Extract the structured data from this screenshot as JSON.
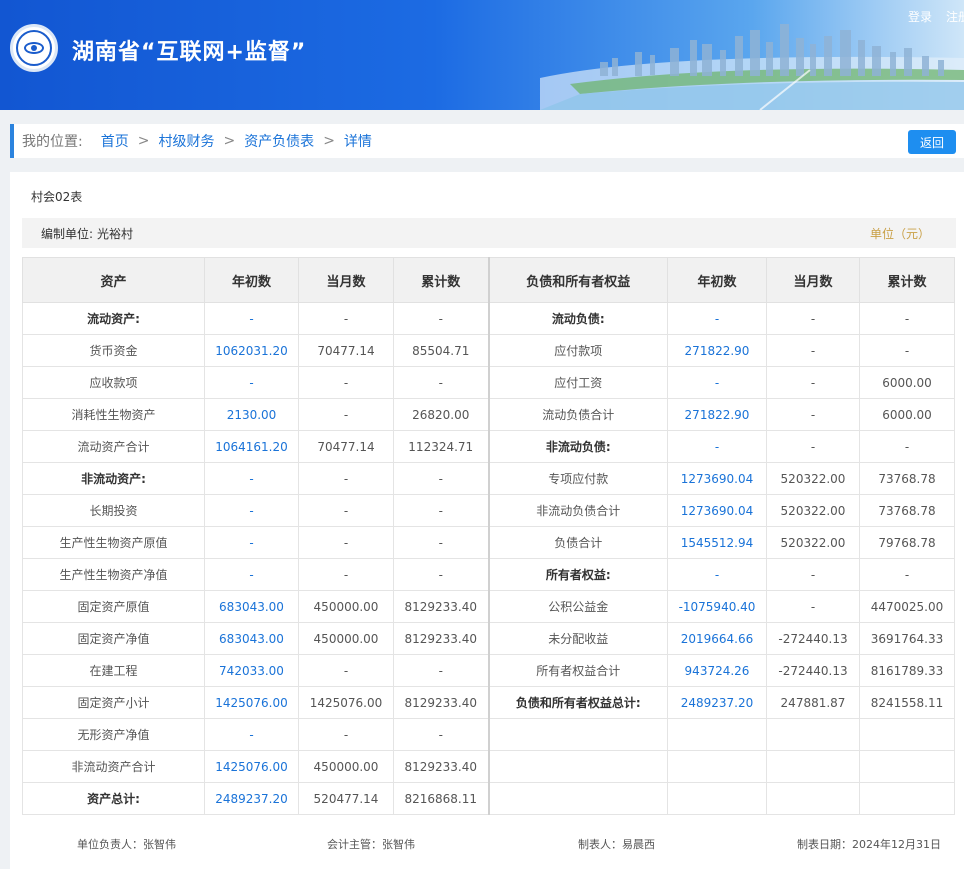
{
  "header": {
    "site_title": "湖南省“互联网+监督”",
    "login": "登录",
    "register": "注册"
  },
  "breadcrumb": {
    "label": "我的位置:",
    "items": [
      "首页",
      "村级财务",
      "资产负债表",
      "详情"
    ],
    "back_button": "返回"
  },
  "report": {
    "code": "村会02表",
    "org_label": "编制单位:",
    "org_name": "光裕村",
    "unit": "单位（元）"
  },
  "table": {
    "headers": [
      "资产",
      "年初数",
      "当月数",
      "累计数",
      "负债和所有者权益",
      "年初数",
      "当月数",
      "累计数"
    ],
    "rows": [
      {
        "a_name": "流动资产:",
        "a_bold": true,
        "a_begin": "-",
        "a_month": "-",
        "a_total": "-",
        "l_name": "流动负债:",
        "l_bold": true,
        "l_begin": "-",
        "l_month": "-",
        "l_total": "-"
      },
      {
        "a_name": "货币资金",
        "a_begin": "1062031.20",
        "a_month": "70477.14",
        "a_total": "85504.71",
        "l_name": "应付款项",
        "l_begin": "271822.90",
        "l_month": "-",
        "l_total": "-"
      },
      {
        "a_name": "应收款项",
        "a_begin": "-",
        "a_month": "-",
        "a_total": "-",
        "l_name": "应付工资",
        "l_begin": "-",
        "l_month": "-",
        "l_total": "6000.00"
      },
      {
        "a_name": "消耗性生物资产",
        "a_begin": "2130.00",
        "a_month": "-",
        "a_total": "26820.00",
        "l_name": "流动负债合计",
        "l_begin": "271822.90",
        "l_month": "-",
        "l_total": "6000.00"
      },
      {
        "a_name": "流动资产合计",
        "a_begin": "1064161.20",
        "a_month": "70477.14",
        "a_total": "112324.71",
        "l_name": "非流动负债:",
        "l_bold": true,
        "l_begin": "-",
        "l_month": "-",
        "l_total": "-"
      },
      {
        "a_name": "非流动资产:",
        "a_bold": true,
        "a_begin": "-",
        "a_month": "-",
        "a_total": "-",
        "l_name": "专项应付款",
        "l_begin": "1273690.04",
        "l_month": "520322.00",
        "l_total": "73768.78"
      },
      {
        "a_name": "长期投资",
        "a_begin": "-",
        "a_month": "-",
        "a_total": "-",
        "l_name": "非流动负债合计",
        "l_begin": "1273690.04",
        "l_month": "520322.00",
        "l_total": "73768.78"
      },
      {
        "a_name": "生产性生物资产原值",
        "a_begin": "-",
        "a_month": "-",
        "a_total": "-",
        "l_name": "负债合计",
        "l_begin": "1545512.94",
        "l_month": "520322.00",
        "l_total": "79768.78"
      },
      {
        "a_name": "生产性生物资产净值",
        "a_begin": "-",
        "a_month": "-",
        "a_total": "-",
        "l_name": "所有者权益:",
        "l_bold": true,
        "l_begin": "-",
        "l_month": "-",
        "l_total": "-"
      },
      {
        "a_name": "固定资产原值",
        "a_begin": "683043.00",
        "a_month": "450000.00",
        "a_total": "8129233.40",
        "l_name": "公积公益金",
        "l_begin": "-1075940.40",
        "l_month": "-",
        "l_total": "4470025.00"
      },
      {
        "a_name": "固定资产净值",
        "a_begin": "683043.00",
        "a_month": "450000.00",
        "a_total": "8129233.40",
        "l_name": "未分配收益",
        "l_begin": "2019664.66",
        "l_month": "-272440.13",
        "l_total": "3691764.33"
      },
      {
        "a_name": "在建工程",
        "a_begin": "742033.00",
        "a_month": "-",
        "a_total": "-",
        "l_name": "所有者权益合计",
        "l_begin": "943724.26",
        "l_month": "-272440.13",
        "l_total": "8161789.33"
      },
      {
        "a_name": "固定资产小计",
        "a_begin": "1425076.00",
        "a_month": "1425076.00",
        "a_total": "8129233.40",
        "l_name": "负债和所有者权益总计:",
        "l_bold": true,
        "l_begin": "2489237.20",
        "l_month": "247881.87",
        "l_total": "8241558.11"
      },
      {
        "a_name": "无形资产净值",
        "a_begin": "-",
        "a_month": "-",
        "a_total": "-",
        "l_name": "",
        "l_begin": "",
        "l_month": "",
        "l_total": ""
      },
      {
        "a_name": "非流动资产合计",
        "a_begin": "1425076.00",
        "a_month": "450000.00",
        "a_total": "8129233.40",
        "l_name": "",
        "l_begin": "",
        "l_month": "",
        "l_total": ""
      },
      {
        "a_name": "资产总计:",
        "a_bold": true,
        "a_begin": "2489237.20",
        "a_month": "520477.14",
        "a_total": "8216868.11",
        "l_name": "",
        "l_begin": "",
        "l_month": "",
        "l_total": ""
      }
    ]
  },
  "footer": {
    "unit_head": "单位负责人：张智伟",
    "accountant": "会计主管：张智伟",
    "preparer": "制表人：易晨西",
    "date": "制表日期：2024年12月31日"
  }
}
